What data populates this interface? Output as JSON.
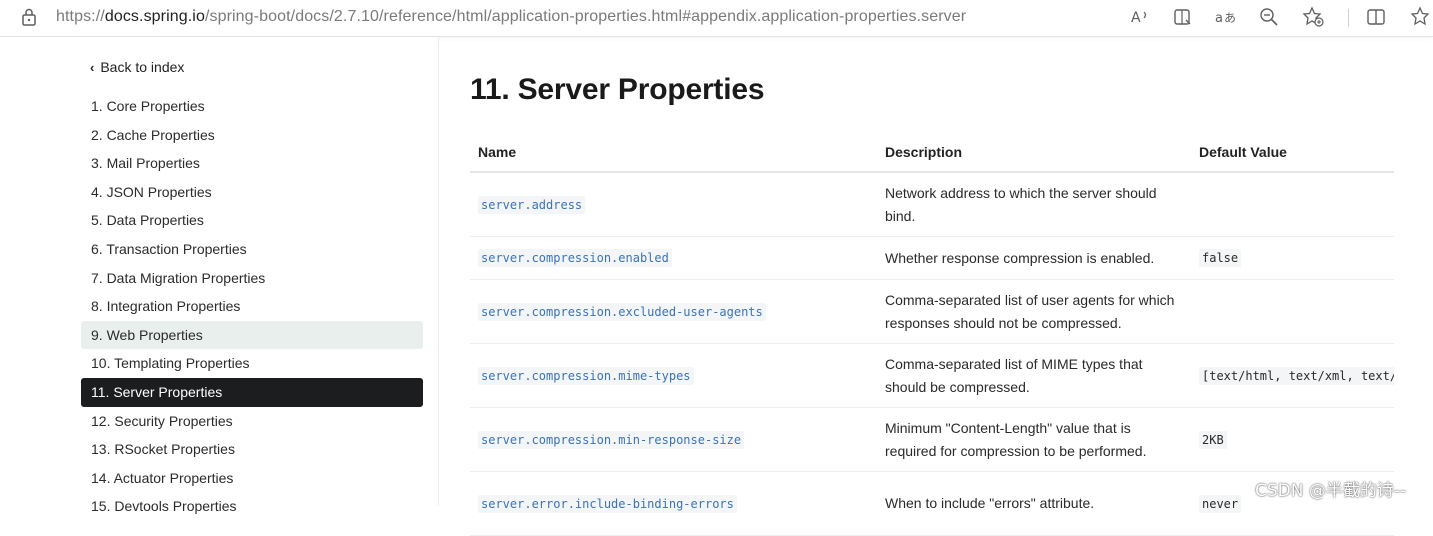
{
  "browser": {
    "url_prefix": "https://",
    "url_domain": "docs.spring.io",
    "url_path": "/spring-boot/docs/2.7.10/reference/html/application-properties.html#appendix.application-properties.server",
    "icons": [
      "read-aloud-icon",
      "immersive-reader-icon",
      "translate-icon",
      "zoom-icon",
      "favorite-add-icon",
      "split-screen-icon",
      "favorites-icon"
    ]
  },
  "sidebar": {
    "back_label": "Back to index",
    "items": [
      {
        "label": "1. Core Properties"
      },
      {
        "label": "2. Cache Properties"
      },
      {
        "label": "3. Mail Properties"
      },
      {
        "label": "4. JSON Properties"
      },
      {
        "label": "5. Data Properties"
      },
      {
        "label": "6. Transaction Properties"
      },
      {
        "label": "7. Data Migration Properties"
      },
      {
        "label": "8. Integration Properties"
      },
      {
        "label": "9. Web Properties"
      },
      {
        "label": "10. Templating Properties"
      },
      {
        "label": "11. Server Properties"
      },
      {
        "label": "12. Security Properties"
      },
      {
        "label": "13. RSocket Properties"
      },
      {
        "label": "14. Actuator Properties"
      },
      {
        "label": "15. Devtools Properties"
      }
    ]
  },
  "main": {
    "title": "11. Server Properties",
    "columns": [
      "Name",
      "Description",
      "Default Value"
    ],
    "rows": [
      {
        "name": "server.address",
        "description": "Network address to which the server should bind.",
        "default": ""
      },
      {
        "name": "server.compression.enabled",
        "description": "Whether response compression is enabled.",
        "default": "false"
      },
      {
        "name": "server.compression.excluded-user-agents",
        "description": "Comma-separated list of user agents for which responses should not be compressed.",
        "default": ""
      },
      {
        "name": "server.compression.mime-types",
        "description": "Comma-separated list of MIME types that should be compressed.",
        "default": "[text/html, text/xml, text/plain, text/css, text/javascript, application/javascript, application/json, application/xml]"
      },
      {
        "name": "server.compression.min-response-size",
        "description": "Minimum \"Content-Length\" value that is required for compression to be performed.",
        "default": "2KB"
      },
      {
        "name": "server.error.include-binding-errors",
        "description": "When to include \"errors\" attribute.",
        "default": "never"
      }
    ]
  },
  "watermark": "CSDN @半截的诗--"
}
